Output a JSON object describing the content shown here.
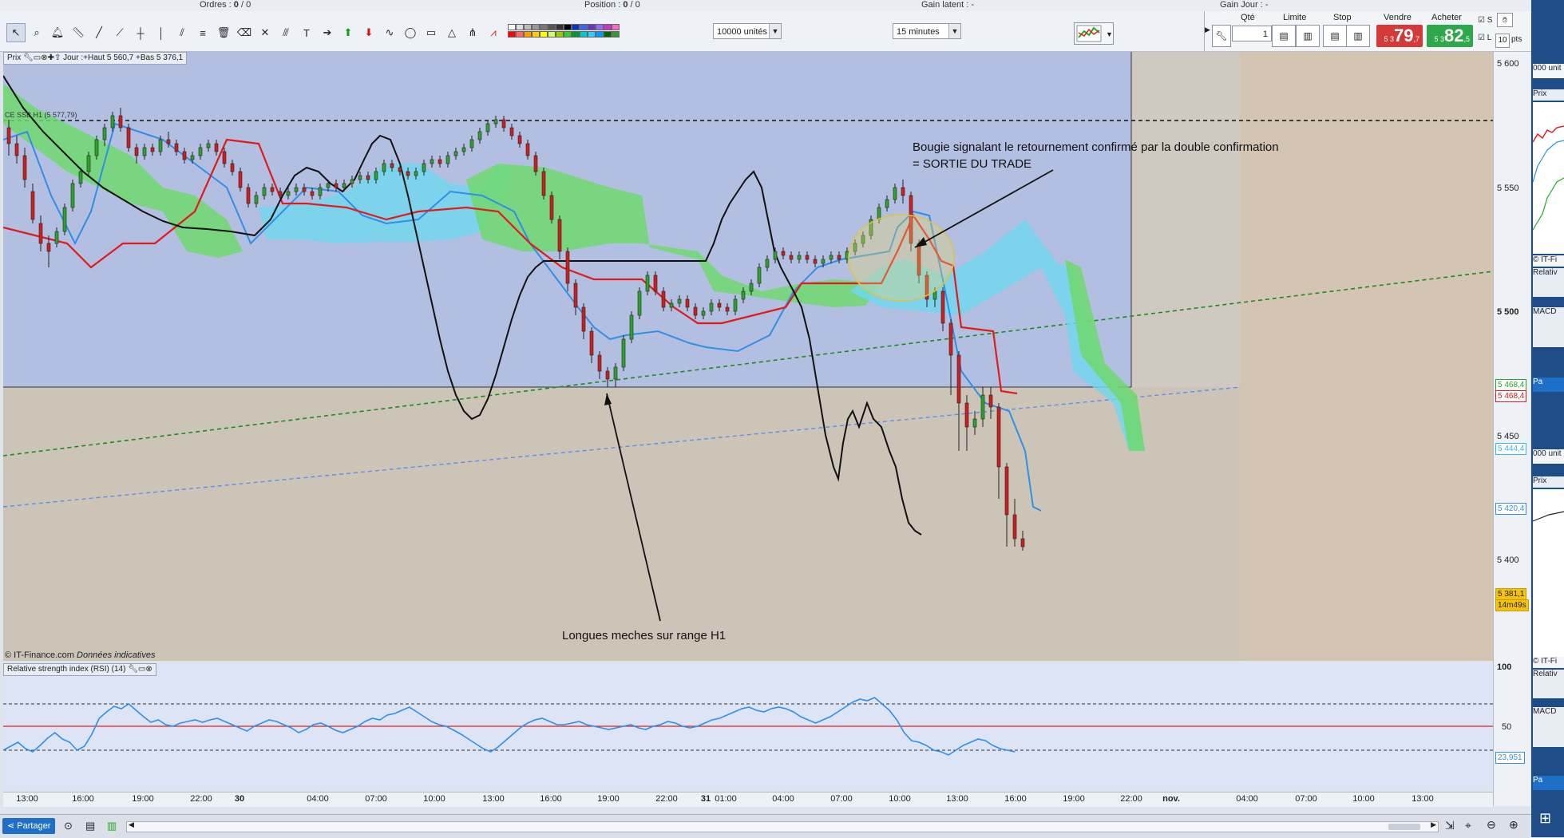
{
  "status": {
    "ordres_label": "Ordres : ",
    "ordres_value": "0",
    "ordres_sub": "/ 0",
    "position_label": "Position : ",
    "position_value": "0",
    "position_sub": "/ 0",
    "gain_latent": "Gain latent : -",
    "gain_jour": "Gain Jour : -"
  },
  "toolbar": {
    "quantity_select": "10000 unités",
    "timeframe_select": "15 minutes"
  },
  "order_panel": {
    "qty_label": "Qté",
    "qty_value": "1",
    "limit_label": "Limite",
    "stop_label": "Stop",
    "sell_label": "Vendre",
    "buy_label": "Acheter",
    "sell_prefix": "5 3",
    "sell_big": "79",
    "sell_suffix": ",7",
    "buy_prefix": "5 3",
    "buy_big": "82",
    "buy_suffix": ",5",
    "s_label": "S",
    "l_label": "L",
    "pts_value": "10",
    "pts_label": "pts"
  },
  "price_chart": {
    "header_label": "Prix",
    "header_info": "Jour :+Haut 5 560,7 +Bas 5 376,1",
    "ssb_label": "CE SSB H1 (5 577,79)",
    "annotation_exit_line1": "Bougie signalant le retournement confirmé par la double confirmation",
    "annotation_exit_line2": "= SORTIE DU TRADE",
    "annotation_wicks": "Longues meches sur range H1",
    "footer_source": "© IT-Finance.com",
    "footer_note": "Données indicatives"
  },
  "rsi_panel": {
    "title": "Relative strength index (RSI) (14)",
    "level_100": "100",
    "level_50": "50",
    "current_value": "23,951"
  },
  "price_axis": {
    "ticks": [
      "5 600",
      "5 550",
      "5 500",
      "5 450",
      "5 400"
    ],
    "tags": [
      {
        "text": "5 468,4",
        "color": "#2aa52a"
      },
      {
        "text": "5 468,4",
        "color": "#d41c1c"
      },
      {
        "text": "5 444,4",
        "color": "#39b7e6"
      },
      {
        "text": "5 420,4",
        "color": "#3a8ee0"
      },
      {
        "text": "5 381,1",
        "color": "#222222",
        "bg": "#f4c20d"
      },
      {
        "text": "14m49s",
        "color": "#222222",
        "bg": "#f4c20d"
      }
    ]
  },
  "time_axis": {
    "labels": [
      "13:00",
      "16:00",
      "19:00",
      "22:00",
      "30",
      "04:00",
      "07:00",
      "10:00",
      "13:00",
      "16:00",
      "19:00",
      "22:00",
      "31",
      "01:00",
      "04:00",
      "07:00",
      "10:00",
      "13:00",
      "16:00",
      "19:00",
      "22:00",
      "nov.",
      "04:00",
      "07:00",
      "10:00",
      "13:00"
    ]
  },
  "bottom": {
    "share_label": "Partager"
  },
  "side_panel": {
    "items": [
      "000 unit",
      "Prix",
      "© IT-Fi",
      "Relativ",
      "MACD",
      "Pa",
      "000 unit",
      "Prix",
      "© IT-Fi",
      "Relativ",
      "MACD",
      "Pa"
    ]
  },
  "colors": {
    "chart_bg_top": "#b3bfe0",
    "chart_bg_bottom": "#cdc4b8",
    "cloud_green": "#6fd86f",
    "cloud_blue": "#6fd8ef",
    "tenkan": "#e01b1b",
    "kijun": "#2f8fe6",
    "chikou": "#111111",
    "sell": "#d43a3a",
    "buy": "#2ea84a"
  }
}
